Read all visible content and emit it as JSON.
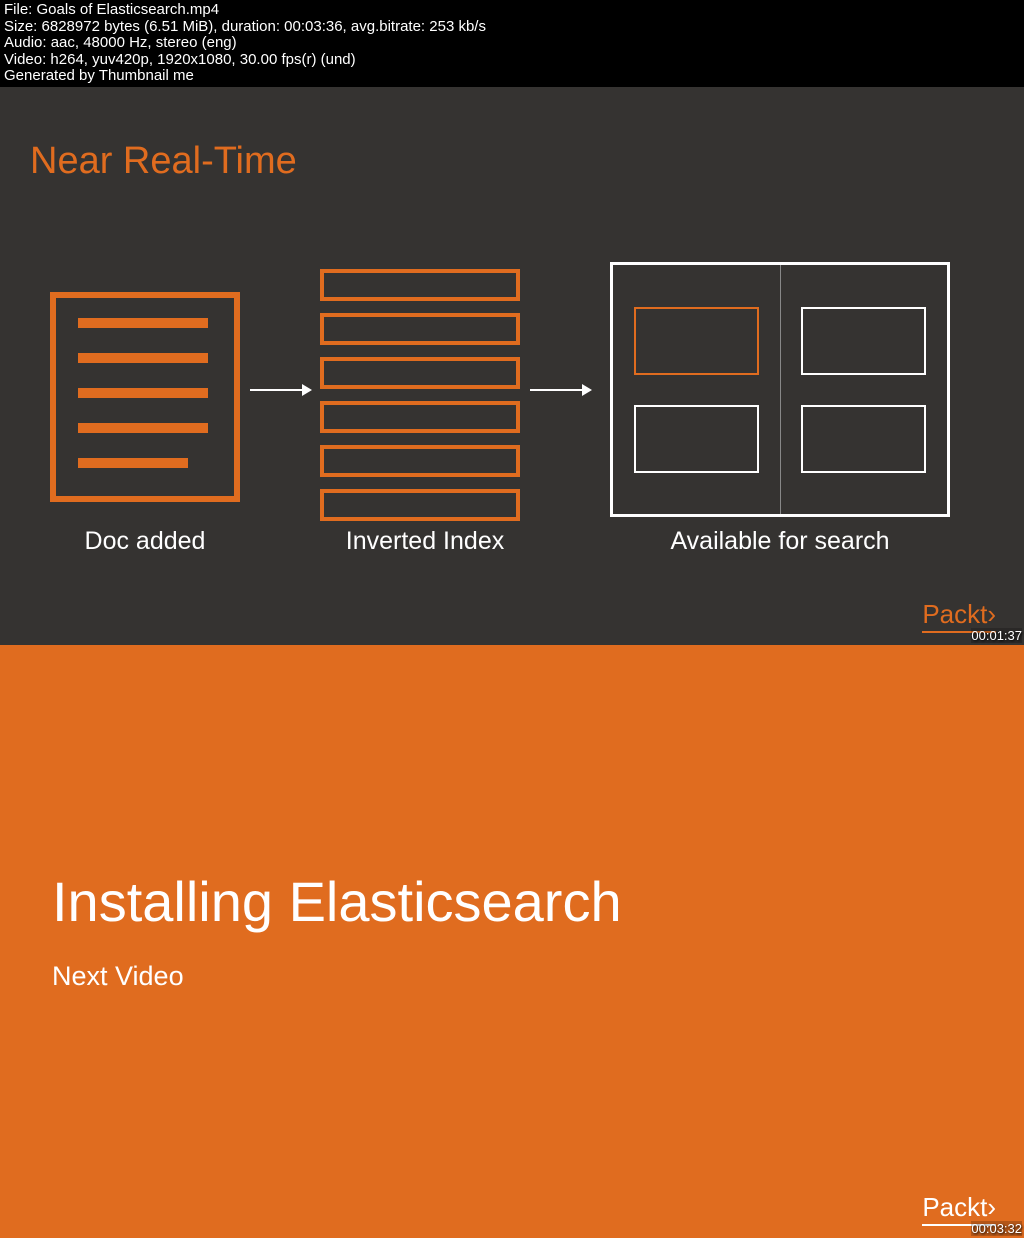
{
  "header": {
    "file": "File: Goals of Elasticsearch.mp4",
    "size": "Size: 6828972 bytes (6.51 MiB), duration: 00:03:36, avg.bitrate: 253 kb/s",
    "audio": "Audio: aac, 48000 Hz, stereo (eng)",
    "video": "Video: h264, yuv420p, 1920x1080, 30.00 fps(r) (und)",
    "generated": "Generated by Thumbnail me"
  },
  "frame1": {
    "title": "Near Real-Time",
    "label1": "Doc added",
    "label2": "Inverted Index",
    "label3": "Available for search",
    "brand": "Packt›",
    "timestamp": "00:01:37"
  },
  "frame2": {
    "title": "Installing Elasticsearch",
    "subtitle": "Next Video",
    "brand": "Packt›",
    "timestamp": "00:03:32"
  }
}
